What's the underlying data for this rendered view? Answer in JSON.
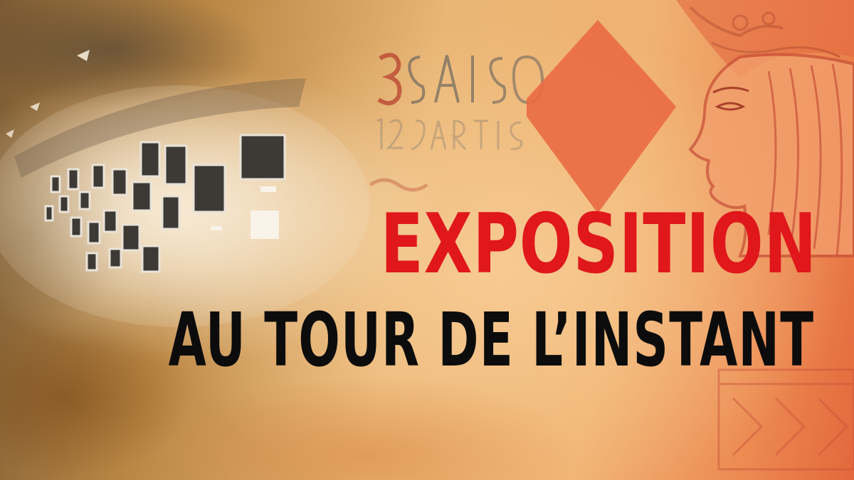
{
  "headline": {
    "title": "EXPOSITION",
    "subtitle": "AU TOUR DE L’INSTANT"
  },
  "colors": {
    "title": "#e0171b",
    "subtitle": "#0c0c0c",
    "background_warm": "#f0b271",
    "background_red": "#e4683c"
  },
  "imagery": {
    "gallery_photo": "exhibition-wall-with-framed-photographs",
    "card_art": "playing-card-queen-with-diamond"
  }
}
